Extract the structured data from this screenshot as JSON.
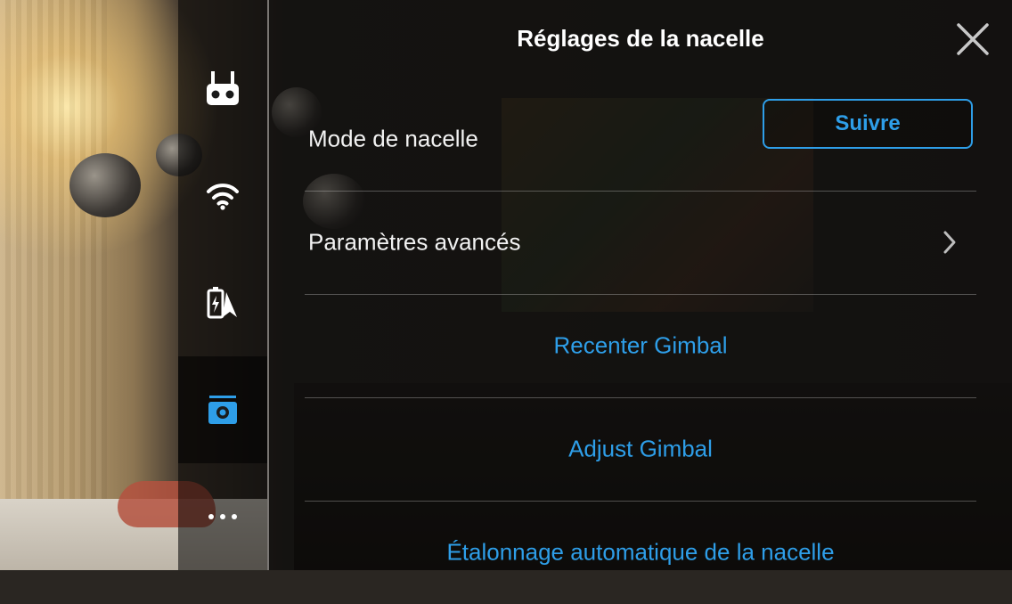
{
  "header": {
    "title": "Réglages de la nacelle"
  },
  "sidebar": {
    "items": [
      {
        "icon": "remote-controller-icon",
        "active": false
      },
      {
        "icon": "wifi-icon",
        "active": false
      },
      {
        "icon": "battery-aircraft-icon",
        "active": false
      },
      {
        "icon": "camera-gimbal-icon",
        "active": true
      },
      {
        "icon": "more-dots-icon",
        "active": false
      }
    ]
  },
  "settings": {
    "gimbal_mode_label": "Mode de nacelle",
    "gimbal_mode_value": "Suivre",
    "advanced_label": "Paramètres avancés",
    "recenter_label": "Recenter Gimbal",
    "adjust_label": "Adjust Gimbal",
    "auto_calibration_label": "Étalonnage automatique de la nacelle"
  },
  "colors": {
    "accent": "#2e9ee8",
    "text": "#f2f2f2"
  }
}
